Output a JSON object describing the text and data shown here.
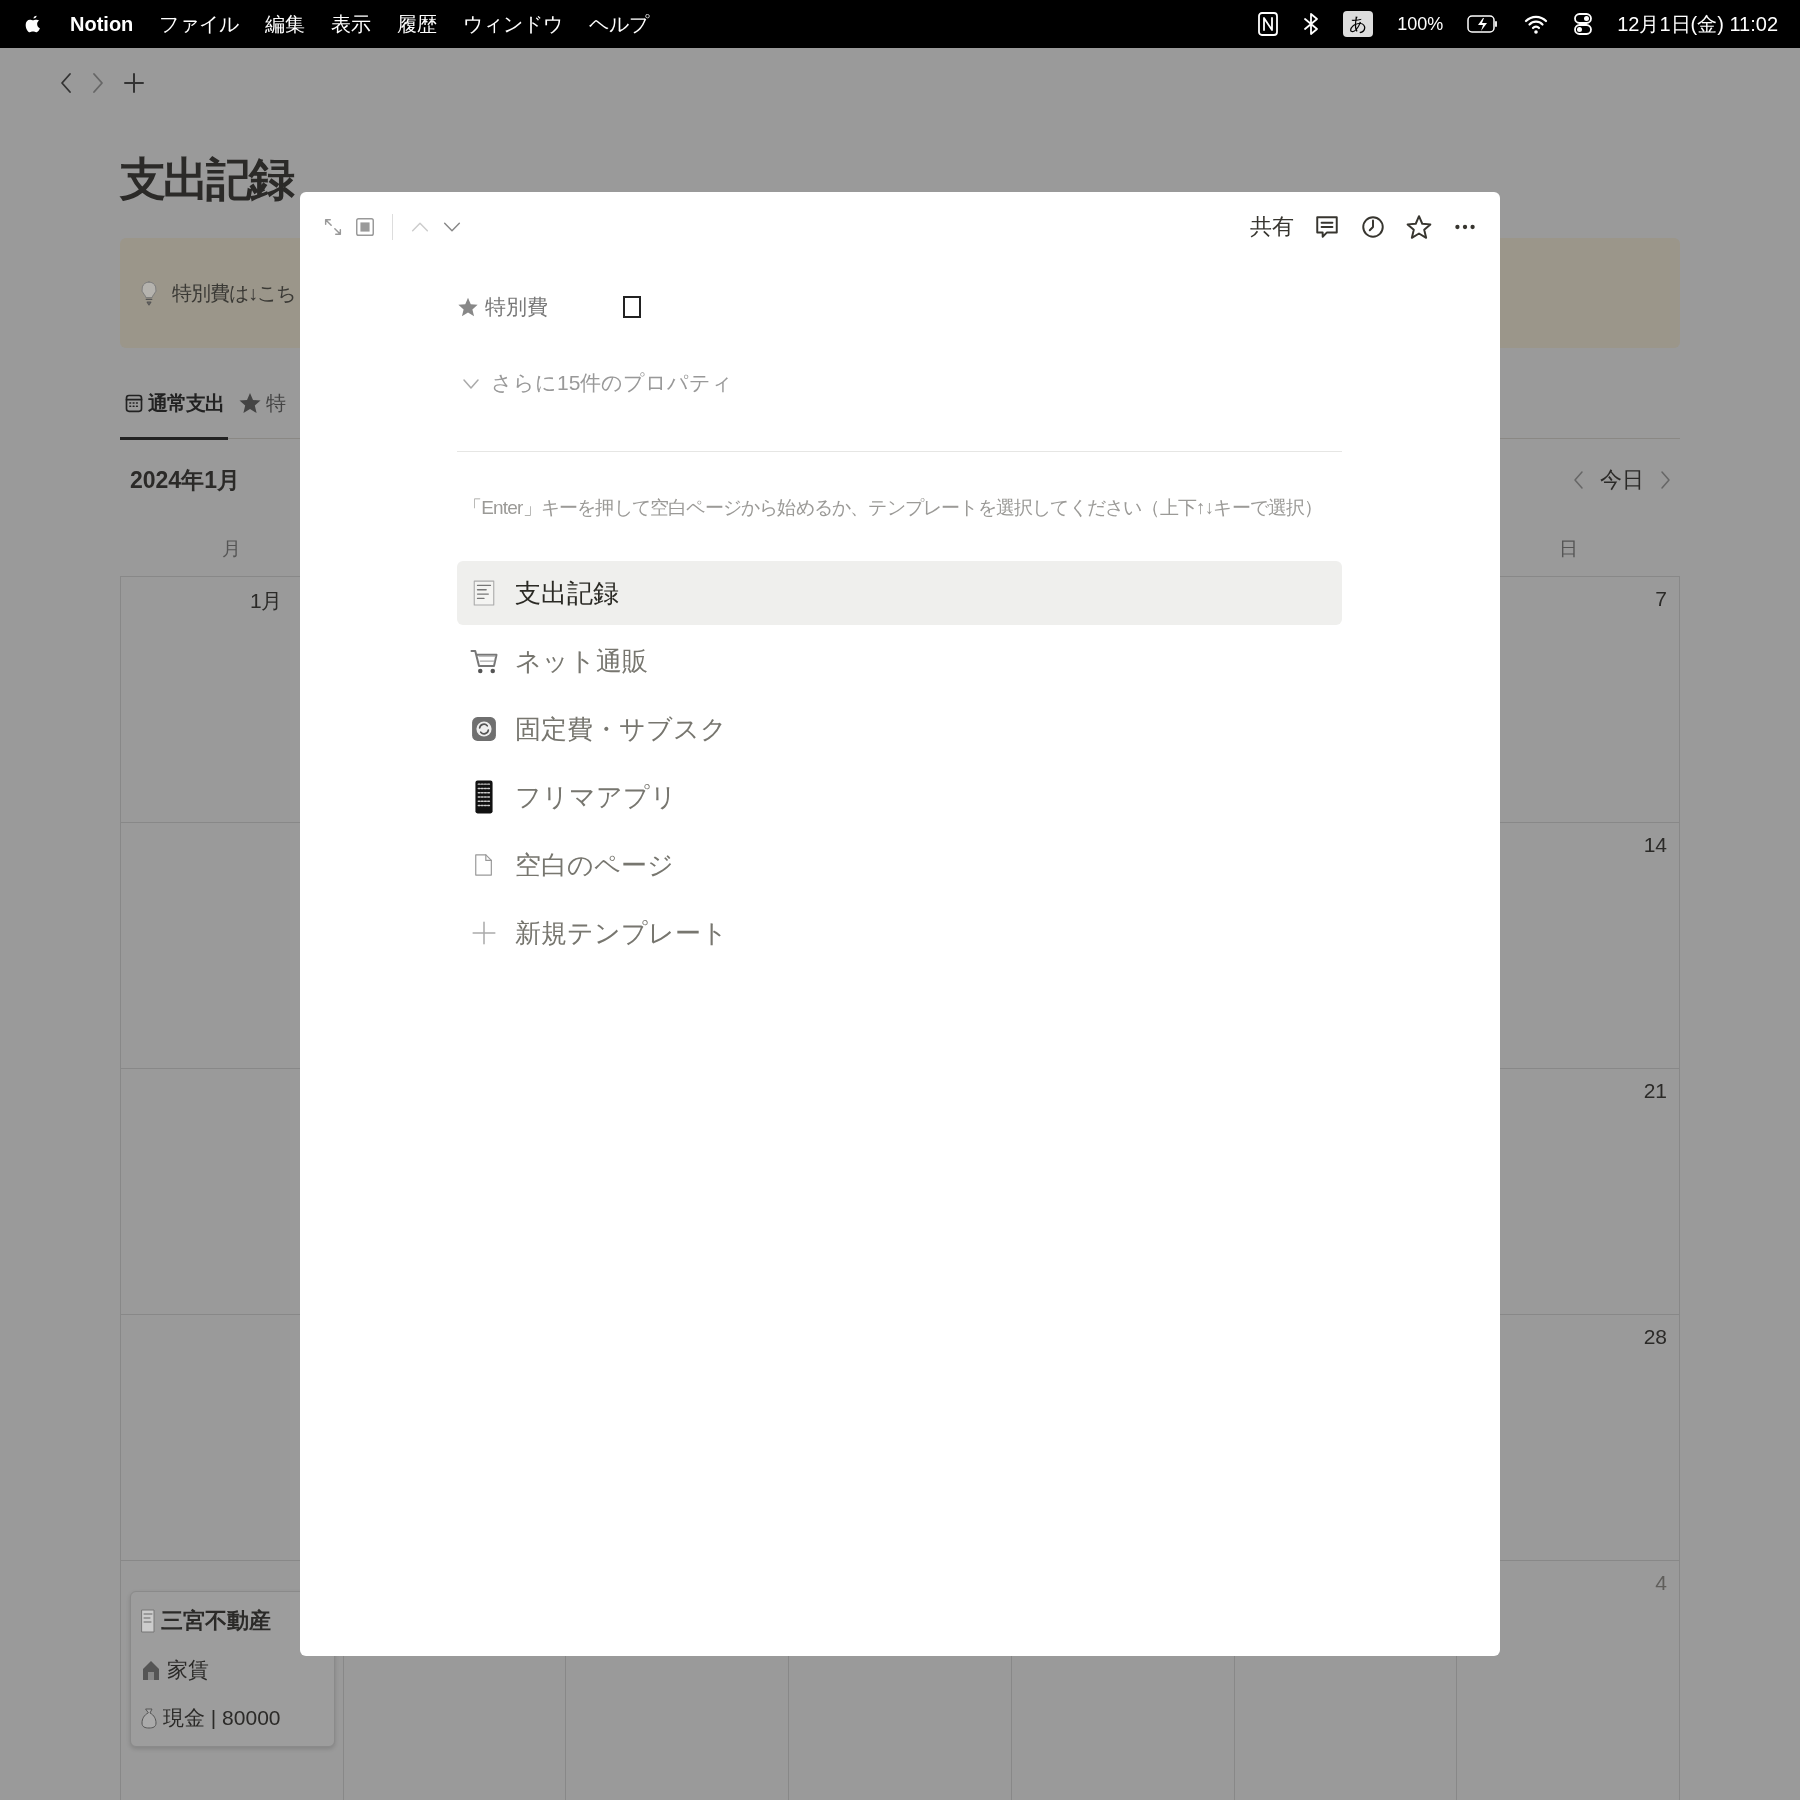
{
  "menubar": {
    "app": "Notion",
    "menus": [
      "ファイル",
      "編集",
      "表示",
      "履歴",
      "ウィンドウ",
      "ヘルプ"
    ],
    "input_method": "あ",
    "battery": "100%",
    "clock": "12月1日(金) 11:02"
  },
  "page": {
    "title": "支出記録",
    "callout": "特別費は↓こち",
    "tabs": [
      {
        "label": "通常支出",
        "kind": "calendar",
        "selected": true
      },
      {
        "label": "特",
        "kind": "star",
        "selected": false
      }
    ],
    "month": "2024年1月",
    "today": "今日",
    "weekdays": {
      "first": "月",
      "last": "日"
    },
    "weeks": [
      {
        "first_day": "1月",
        "last_day": "7",
        "other_month": false
      },
      {
        "last_day": "14",
        "other_month": false
      },
      {
        "last_day": "21",
        "other_month": false
      },
      {
        "last_day": "28",
        "other_month": false
      },
      {
        "last_day": "4",
        "other_month": true,
        "card": {
          "title": "三宮不動産",
          "category": "家賃",
          "payment": "現金 | 80000"
        }
      }
    ]
  },
  "modal": {
    "share": "共有",
    "property": {
      "label": "特別費",
      "checked": false
    },
    "more_properties": "さらに15件のプロパティ",
    "hint": "「Enter」キーを押して空白ページから始めるか、テンプレートを選択してください（上下↑↓キーで選択）",
    "templates": [
      {
        "label": "支出記録",
        "kind": "receipt",
        "selected": true
      },
      {
        "label": "ネット通販",
        "kind": "cart",
        "selected": false
      },
      {
        "label": "固定費・サブスク",
        "kind": "cycle",
        "selected": false
      },
      {
        "label": "フリマアプリ",
        "kind": "phone",
        "selected": false
      },
      {
        "label": "空白のページ",
        "kind": "page",
        "selected": false
      },
      {
        "label": "新規テンプレート",
        "kind": "plus",
        "selected": false
      }
    ]
  }
}
